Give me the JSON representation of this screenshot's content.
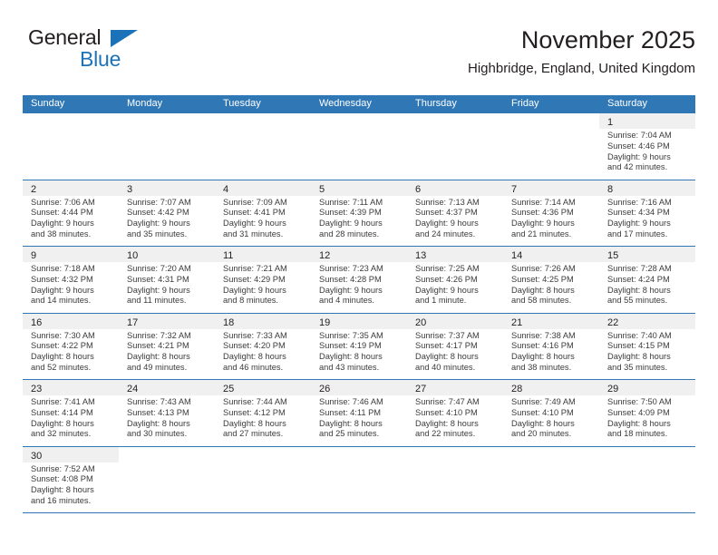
{
  "brand": {
    "name_primary": "General",
    "name_secondary": "Blue",
    "logo_icon": "triangle-flag-icon",
    "accent_color": "#1b72b8"
  },
  "header": {
    "title": "November 2025",
    "subtitle": "Highbridge, England, United Kingdom"
  },
  "theme": {
    "header_blue": "#3077b5",
    "daynum_band": "#f0f0f0",
    "text": "#231f20"
  },
  "calendar": {
    "weekday_headers": [
      "Sunday",
      "Monday",
      "Tuesday",
      "Wednesday",
      "Thursday",
      "Friday",
      "Saturday"
    ],
    "weeks": [
      [
        {
          "day": "",
          "lines": []
        },
        {
          "day": "",
          "lines": []
        },
        {
          "day": "",
          "lines": []
        },
        {
          "day": "",
          "lines": []
        },
        {
          "day": "",
          "lines": []
        },
        {
          "day": "",
          "lines": []
        },
        {
          "day": "1",
          "lines": [
            "Sunrise: 7:04 AM",
            "Sunset: 4:46 PM",
            "Daylight: 9 hours",
            "and 42 minutes."
          ]
        }
      ],
      [
        {
          "day": "2",
          "lines": [
            "Sunrise: 7:06 AM",
            "Sunset: 4:44 PM",
            "Daylight: 9 hours",
            "and 38 minutes."
          ]
        },
        {
          "day": "3",
          "lines": [
            "Sunrise: 7:07 AM",
            "Sunset: 4:42 PM",
            "Daylight: 9 hours",
            "and 35 minutes."
          ]
        },
        {
          "day": "4",
          "lines": [
            "Sunrise: 7:09 AM",
            "Sunset: 4:41 PM",
            "Daylight: 9 hours",
            "and 31 minutes."
          ]
        },
        {
          "day": "5",
          "lines": [
            "Sunrise: 7:11 AM",
            "Sunset: 4:39 PM",
            "Daylight: 9 hours",
            "and 28 minutes."
          ]
        },
        {
          "day": "6",
          "lines": [
            "Sunrise: 7:13 AM",
            "Sunset: 4:37 PM",
            "Daylight: 9 hours",
            "and 24 minutes."
          ]
        },
        {
          "day": "7",
          "lines": [
            "Sunrise: 7:14 AM",
            "Sunset: 4:36 PM",
            "Daylight: 9 hours",
            "and 21 minutes."
          ]
        },
        {
          "day": "8",
          "lines": [
            "Sunrise: 7:16 AM",
            "Sunset: 4:34 PM",
            "Daylight: 9 hours",
            "and 17 minutes."
          ]
        }
      ],
      [
        {
          "day": "9",
          "lines": [
            "Sunrise: 7:18 AM",
            "Sunset: 4:32 PM",
            "Daylight: 9 hours",
            "and 14 minutes."
          ]
        },
        {
          "day": "10",
          "lines": [
            "Sunrise: 7:20 AM",
            "Sunset: 4:31 PM",
            "Daylight: 9 hours",
            "and 11 minutes."
          ]
        },
        {
          "day": "11",
          "lines": [
            "Sunrise: 7:21 AM",
            "Sunset: 4:29 PM",
            "Daylight: 9 hours",
            "and 8 minutes."
          ]
        },
        {
          "day": "12",
          "lines": [
            "Sunrise: 7:23 AM",
            "Sunset: 4:28 PM",
            "Daylight: 9 hours",
            "and 4 minutes."
          ]
        },
        {
          "day": "13",
          "lines": [
            "Sunrise: 7:25 AM",
            "Sunset: 4:26 PM",
            "Daylight: 9 hours",
            "and 1 minute."
          ]
        },
        {
          "day": "14",
          "lines": [
            "Sunrise: 7:26 AM",
            "Sunset: 4:25 PM",
            "Daylight: 8 hours",
            "and 58 minutes."
          ]
        },
        {
          "day": "15",
          "lines": [
            "Sunrise: 7:28 AM",
            "Sunset: 4:24 PM",
            "Daylight: 8 hours",
            "and 55 minutes."
          ]
        }
      ],
      [
        {
          "day": "16",
          "lines": [
            "Sunrise: 7:30 AM",
            "Sunset: 4:22 PM",
            "Daylight: 8 hours",
            "and 52 minutes."
          ]
        },
        {
          "day": "17",
          "lines": [
            "Sunrise: 7:32 AM",
            "Sunset: 4:21 PM",
            "Daylight: 8 hours",
            "and 49 minutes."
          ]
        },
        {
          "day": "18",
          "lines": [
            "Sunrise: 7:33 AM",
            "Sunset: 4:20 PM",
            "Daylight: 8 hours",
            "and 46 minutes."
          ]
        },
        {
          "day": "19",
          "lines": [
            "Sunrise: 7:35 AM",
            "Sunset: 4:19 PM",
            "Daylight: 8 hours",
            "and 43 minutes."
          ]
        },
        {
          "day": "20",
          "lines": [
            "Sunrise: 7:37 AM",
            "Sunset: 4:17 PM",
            "Daylight: 8 hours",
            "and 40 minutes."
          ]
        },
        {
          "day": "21",
          "lines": [
            "Sunrise: 7:38 AM",
            "Sunset: 4:16 PM",
            "Daylight: 8 hours",
            "and 38 minutes."
          ]
        },
        {
          "day": "22",
          "lines": [
            "Sunrise: 7:40 AM",
            "Sunset: 4:15 PM",
            "Daylight: 8 hours",
            "and 35 minutes."
          ]
        }
      ],
      [
        {
          "day": "23",
          "lines": [
            "Sunrise: 7:41 AM",
            "Sunset: 4:14 PM",
            "Daylight: 8 hours",
            "and 32 minutes."
          ]
        },
        {
          "day": "24",
          "lines": [
            "Sunrise: 7:43 AM",
            "Sunset: 4:13 PM",
            "Daylight: 8 hours",
            "and 30 minutes."
          ]
        },
        {
          "day": "25",
          "lines": [
            "Sunrise: 7:44 AM",
            "Sunset: 4:12 PM",
            "Daylight: 8 hours",
            "and 27 minutes."
          ]
        },
        {
          "day": "26",
          "lines": [
            "Sunrise: 7:46 AM",
            "Sunset: 4:11 PM",
            "Daylight: 8 hours",
            "and 25 minutes."
          ]
        },
        {
          "day": "27",
          "lines": [
            "Sunrise: 7:47 AM",
            "Sunset: 4:10 PM",
            "Daylight: 8 hours",
            "and 22 minutes."
          ]
        },
        {
          "day": "28",
          "lines": [
            "Sunrise: 7:49 AM",
            "Sunset: 4:10 PM",
            "Daylight: 8 hours",
            "and 20 minutes."
          ]
        },
        {
          "day": "29",
          "lines": [
            "Sunrise: 7:50 AM",
            "Sunset: 4:09 PM",
            "Daylight: 8 hours",
            "and 18 minutes."
          ]
        }
      ],
      [
        {
          "day": "30",
          "lines": [
            "Sunrise: 7:52 AM",
            "Sunset: 4:08 PM",
            "Daylight: 8 hours",
            "and 16 minutes."
          ]
        },
        {
          "day": "",
          "lines": []
        },
        {
          "day": "",
          "lines": []
        },
        {
          "day": "",
          "lines": []
        },
        {
          "day": "",
          "lines": []
        },
        {
          "day": "",
          "lines": []
        },
        {
          "day": "",
          "lines": []
        }
      ]
    ]
  }
}
